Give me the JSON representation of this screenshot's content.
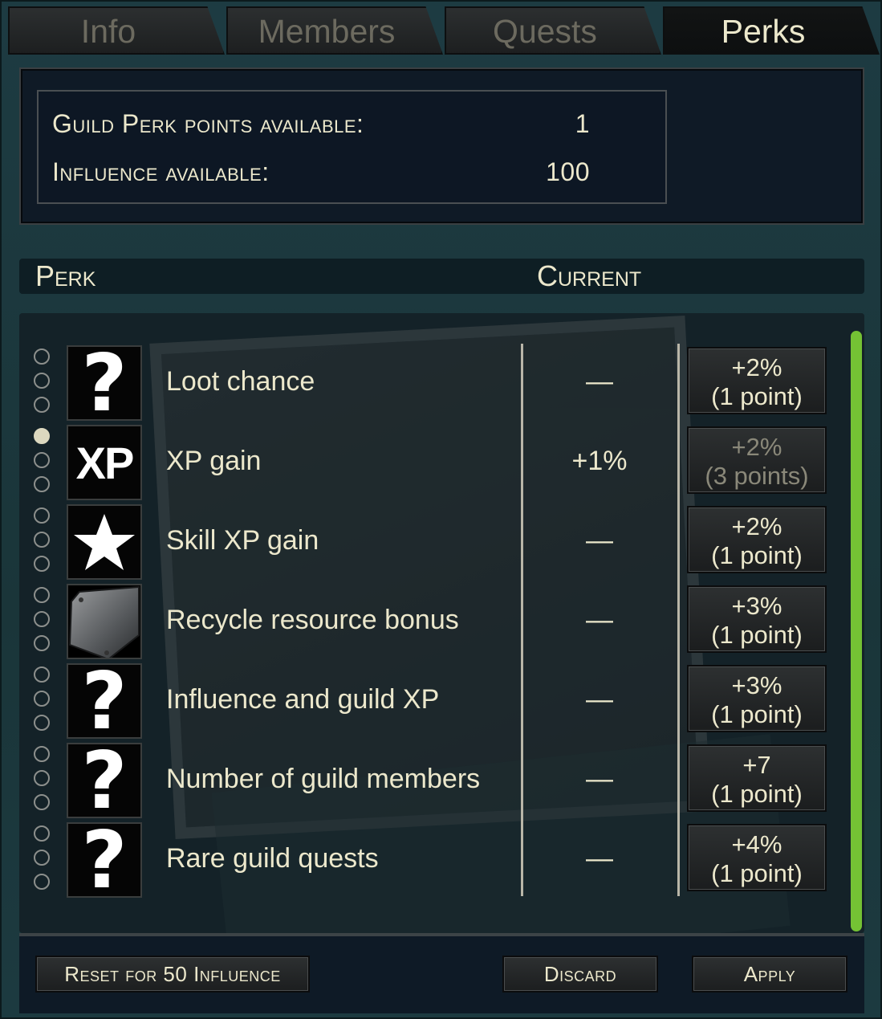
{
  "tabs": [
    {
      "label": "Info",
      "active": false
    },
    {
      "label": "Members",
      "active": false
    },
    {
      "label": "Quests",
      "active": false
    },
    {
      "label": "Perks",
      "active": true
    }
  ],
  "stats": {
    "perk_points_label": "Guild Perk points available:",
    "perk_points_value": "1",
    "influence_label": "Influence available:",
    "influence_value": "100"
  },
  "header": {
    "perk": "Perk",
    "current": "Current"
  },
  "perks": [
    {
      "name": "Loot chance",
      "icon": "question-icon",
      "current": "—",
      "levels_filled": 0,
      "button_line1": "+2%",
      "button_line2": "(1 point)",
      "button_enabled": true
    },
    {
      "name": "XP gain",
      "icon": "xp-icon",
      "current": "+1%",
      "levels_filled": 1,
      "button_line1": "+2%",
      "button_line2": "(3 points)",
      "button_enabled": false
    },
    {
      "name": "Skill XP gain",
      "icon": "star-icon",
      "current": "—",
      "levels_filled": 0,
      "button_line1": "+2%",
      "button_line2": "(1 point)",
      "button_enabled": true
    },
    {
      "name": "Recycle resource bonus",
      "icon": "metal-plate-icon",
      "current": "—",
      "levels_filled": 0,
      "button_line1": "+3%",
      "button_line2": "(1 point)",
      "button_enabled": true
    },
    {
      "name": "Influence and guild XP",
      "icon": "question-icon",
      "current": "—",
      "levels_filled": 0,
      "button_line1": "+3%",
      "button_line2": "(1 point)",
      "button_enabled": true
    },
    {
      "name": "Number of guild members",
      "icon": "question-icon",
      "current": "—",
      "levels_filled": 0,
      "button_line1": "+7",
      "button_line2": "(1 point)",
      "button_enabled": true
    },
    {
      "name": "Rare guild quests",
      "icon": "question-icon",
      "current": "—",
      "levels_filled": 0,
      "button_line1": "+4%",
      "button_line2": "(1 point)",
      "button_enabled": true
    }
  ],
  "footer": {
    "reset_label": "Reset for 50 Influence",
    "discard_label": "Discard",
    "apply_label": "Apply"
  },
  "colors": {
    "accent_scrollbar": "#74c234",
    "text": "#ece8cc",
    "panel": "#0f1a26"
  }
}
